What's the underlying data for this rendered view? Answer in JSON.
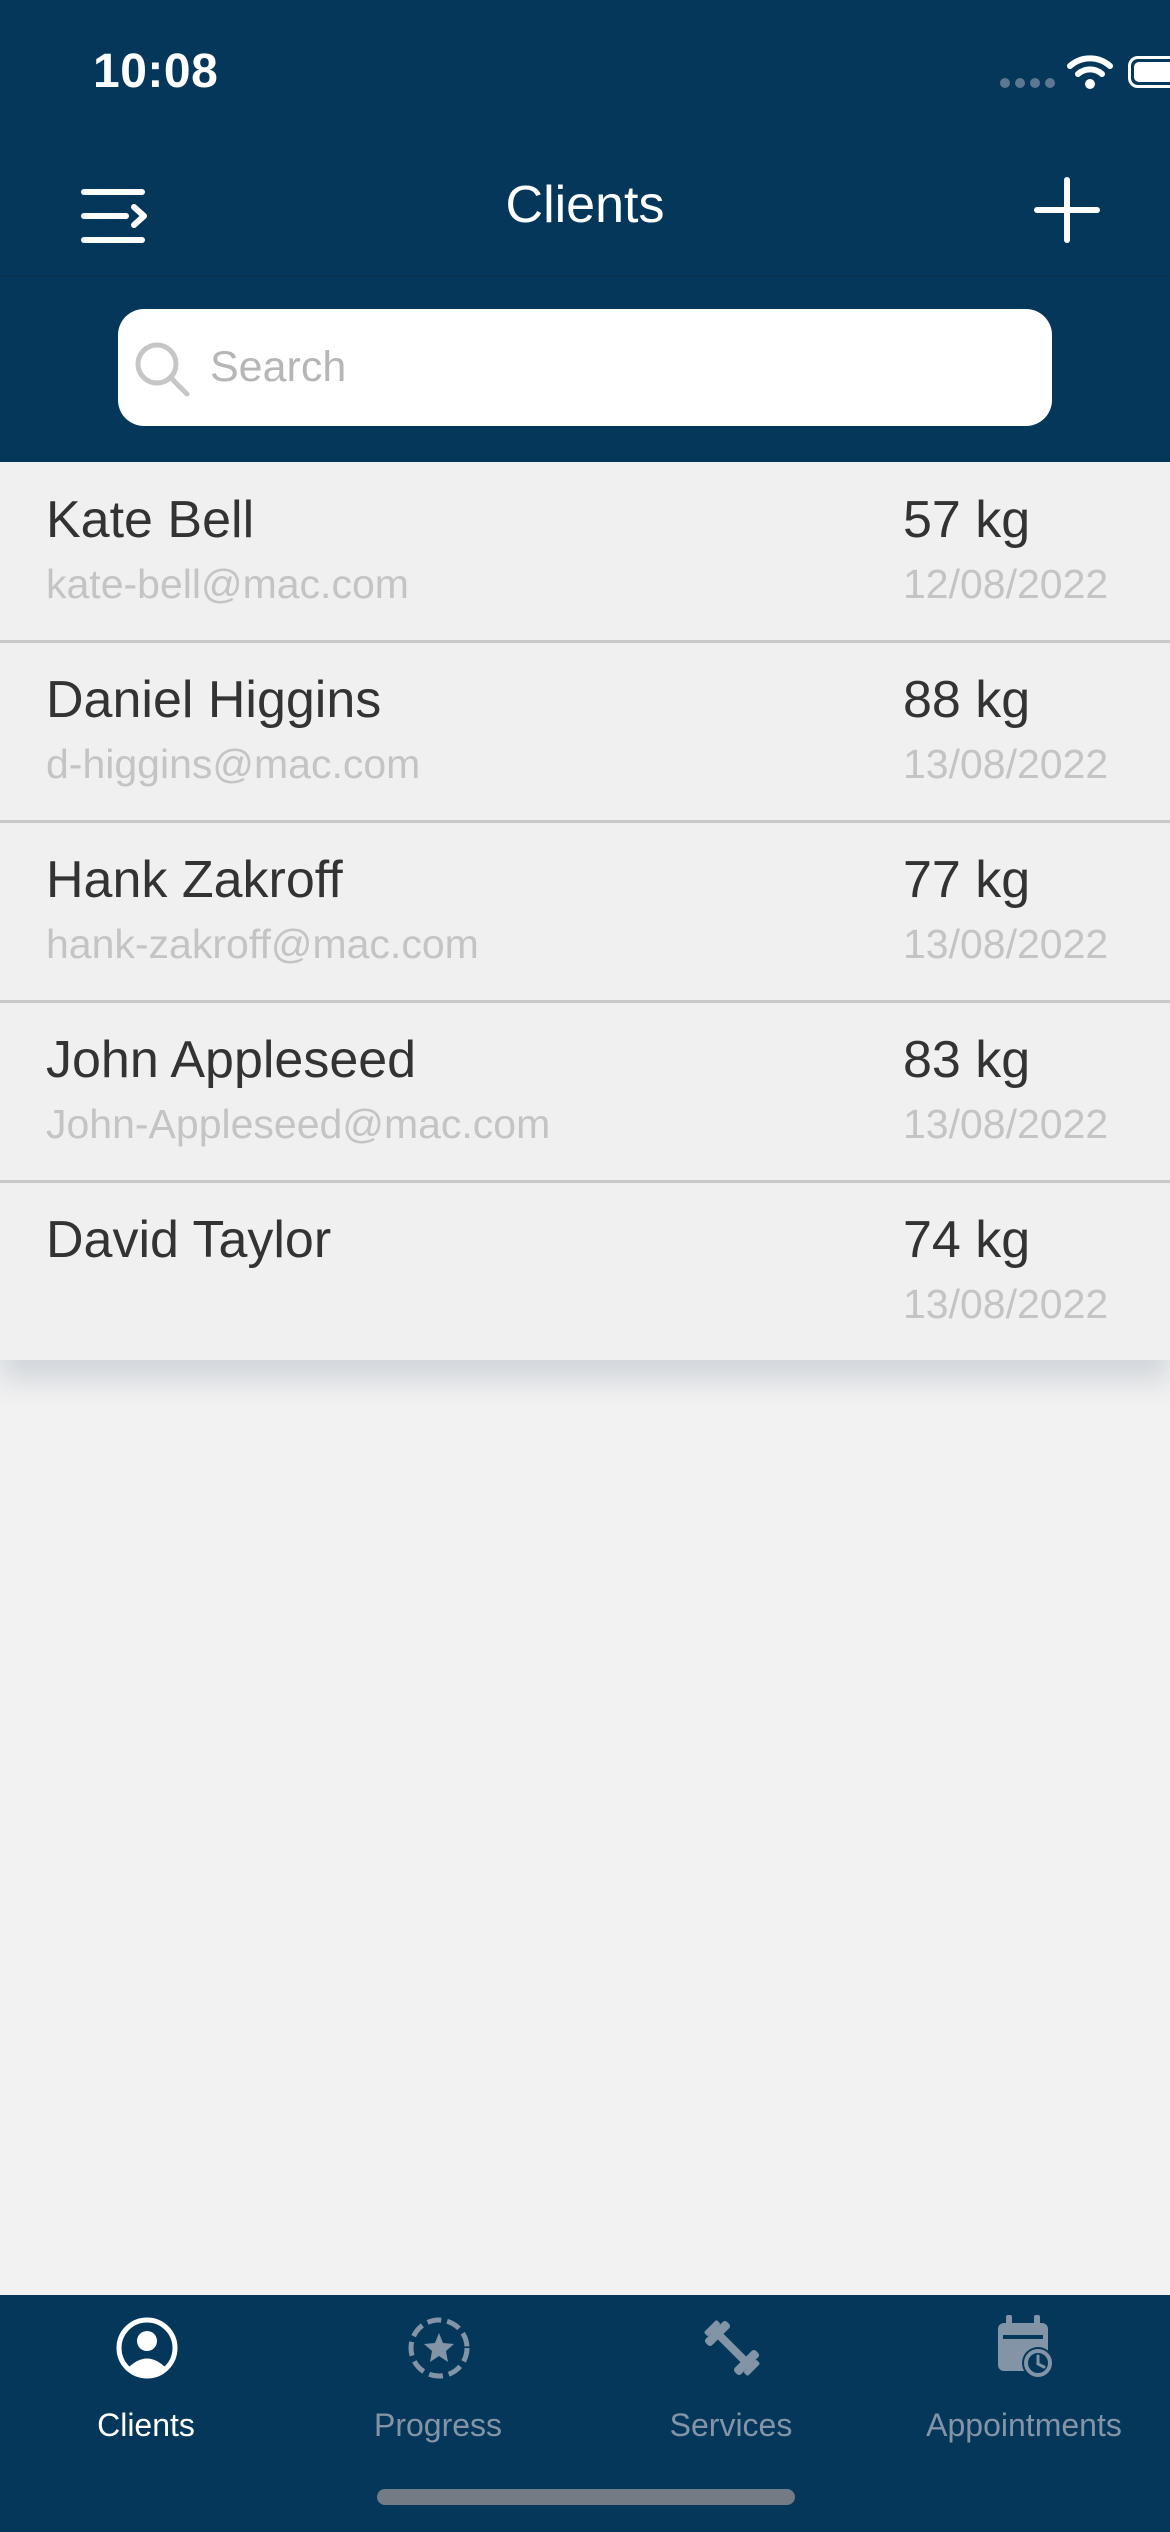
{
  "status_bar": {
    "time": "10:08"
  },
  "nav": {
    "title": "Clients",
    "menu_icon": "menu-icon",
    "add_icon": "plus-icon"
  },
  "search": {
    "placeholder": "Search",
    "value": ""
  },
  "clients": [
    {
      "name": "Kate Bell",
      "email": "kate-bell@mac.com",
      "weight": "57 kg",
      "date": "12/08/2022"
    },
    {
      "name": "Daniel Higgins",
      "email": "d-higgins@mac.com",
      "weight": "88 kg",
      "date": "13/08/2022"
    },
    {
      "name": "Hank Zakroff",
      "email": "hank-zakroff@mac.com",
      "weight": "77 kg",
      "date": "13/08/2022"
    },
    {
      "name": "John Appleseed",
      "email": "John-Appleseed@mac.com",
      "weight": "83 kg",
      "date": "13/08/2022"
    },
    {
      "name": "David Taylor",
      "email": "",
      "weight": "74 kg",
      "date": "13/08/2022"
    }
  ],
  "tabs": [
    {
      "label": "Clients",
      "icon": "person-circle-icon",
      "active": true
    },
    {
      "label": "Progress",
      "icon": "star-badge-icon",
      "active": false
    },
    {
      "label": "Services",
      "icon": "dumbbell-icon",
      "active": false
    },
    {
      "label": "Appointments",
      "icon": "calendar-clock-icon",
      "active": false
    }
  ],
  "colors": {
    "header_bg": "#05375a",
    "list_bg": "#f0f0f0",
    "page_bg": "#f2f2f2",
    "primary_text": "#333333",
    "secondary_text": "#c4c4c4",
    "tab_active": "#ffffff",
    "tab_inactive": "#8394a6"
  }
}
